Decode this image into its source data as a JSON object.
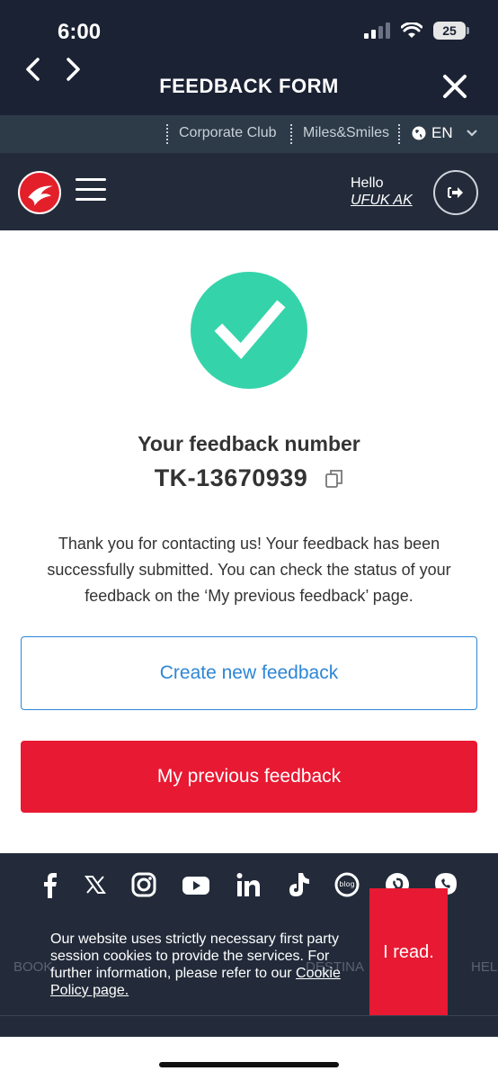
{
  "status_bar": {
    "time": "6:00",
    "battery": "25"
  },
  "browser": {
    "title": "FEEDBACK FORM"
  },
  "top_links": {
    "corporate": "Corporate Club",
    "miles": "Miles&Smiles",
    "language": "EN"
  },
  "header": {
    "greeting": "Hello",
    "user_name": "UFUK AK"
  },
  "confirmation": {
    "label": "Your feedback number",
    "number": "TK-13670939",
    "message": "Thank you for contacting us! Your feedback has been successfully submitted. You can check the status of your feedback on the ‘My previous feedback’ page."
  },
  "actions": {
    "create_label": "Create new feedback",
    "previous_label": "My previous feedback"
  },
  "footer": {
    "socials": [
      "facebook-icon",
      "x-icon",
      "instagram-icon",
      "youtube-icon",
      "linkedin-icon",
      "tiktok-icon",
      "blog-icon",
      "pinterest-icon",
      "whatsapp-icon"
    ],
    "nav": [
      "BOOK",
      "DESTINA",
      "HEL"
    ]
  },
  "cookie": {
    "text": "Our website uses strictly necessary first party session cookies to provide the services. For further information, please refer to our ",
    "link": "Cookie Policy page.",
    "button": "I read."
  },
  "colors": {
    "accent_red": "#e81932",
    "success": "#35d3aa",
    "link_blue": "#2e86d6",
    "navy": "#232b3a"
  }
}
